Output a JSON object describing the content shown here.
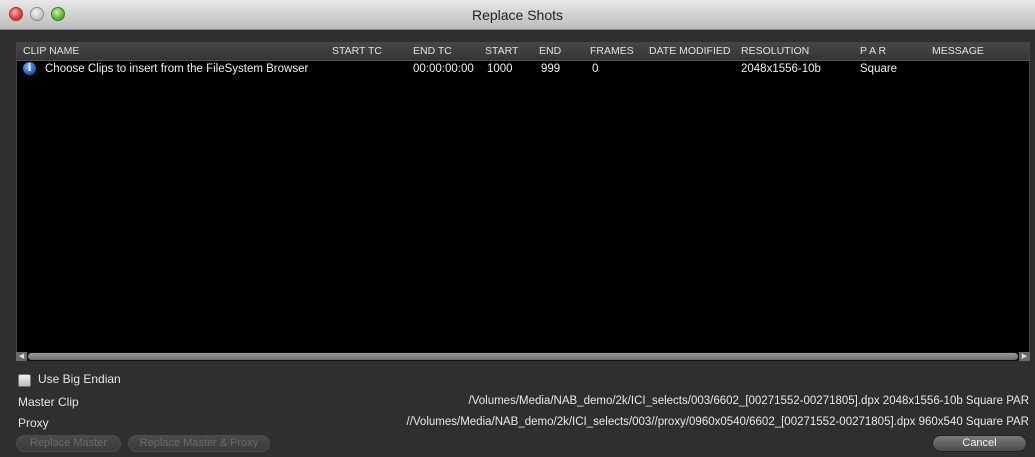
{
  "window": {
    "title": "Replace Shots"
  },
  "table": {
    "columns": [
      "CLIP NAME",
      "START TC",
      "END TC",
      "START",
      "END",
      "FRAMES",
      "DATE MODIFIED",
      "RESOLUTION",
      "P A R",
      "MESSAGE"
    ],
    "rows": [
      {
        "clip_name": "Choose Clips to insert from the FileSystem Browser",
        "start_tc": "",
        "end_tc": "00:00:00:00",
        "start": "1000",
        "end": "999",
        "frames": "0",
        "date_modified": "",
        "resolution": "2048x1556-10b",
        "par": "Square",
        "message": ""
      }
    ]
  },
  "options": {
    "big_endian_label": "Use Big Endian",
    "big_endian_checked": false
  },
  "master": {
    "label": "Master Clip",
    "value": "/Volumes/Media/NAB_demo/2k/ICI_selects/003/6602_[00271552-00271805].dpx  2048x1556-10b  Square PAR"
  },
  "proxy": {
    "label": "Proxy",
    "value": "//Volumes/Media/NAB_demo/2k/ICI_selects/003//proxy/0960x0540/6602_[00271552-00271805].dpx 960x540  Square PAR"
  },
  "buttons": {
    "replace_master": "Replace Master",
    "replace_master_proxy": "Replace Master & Proxy",
    "cancel": "Cancel"
  }
}
